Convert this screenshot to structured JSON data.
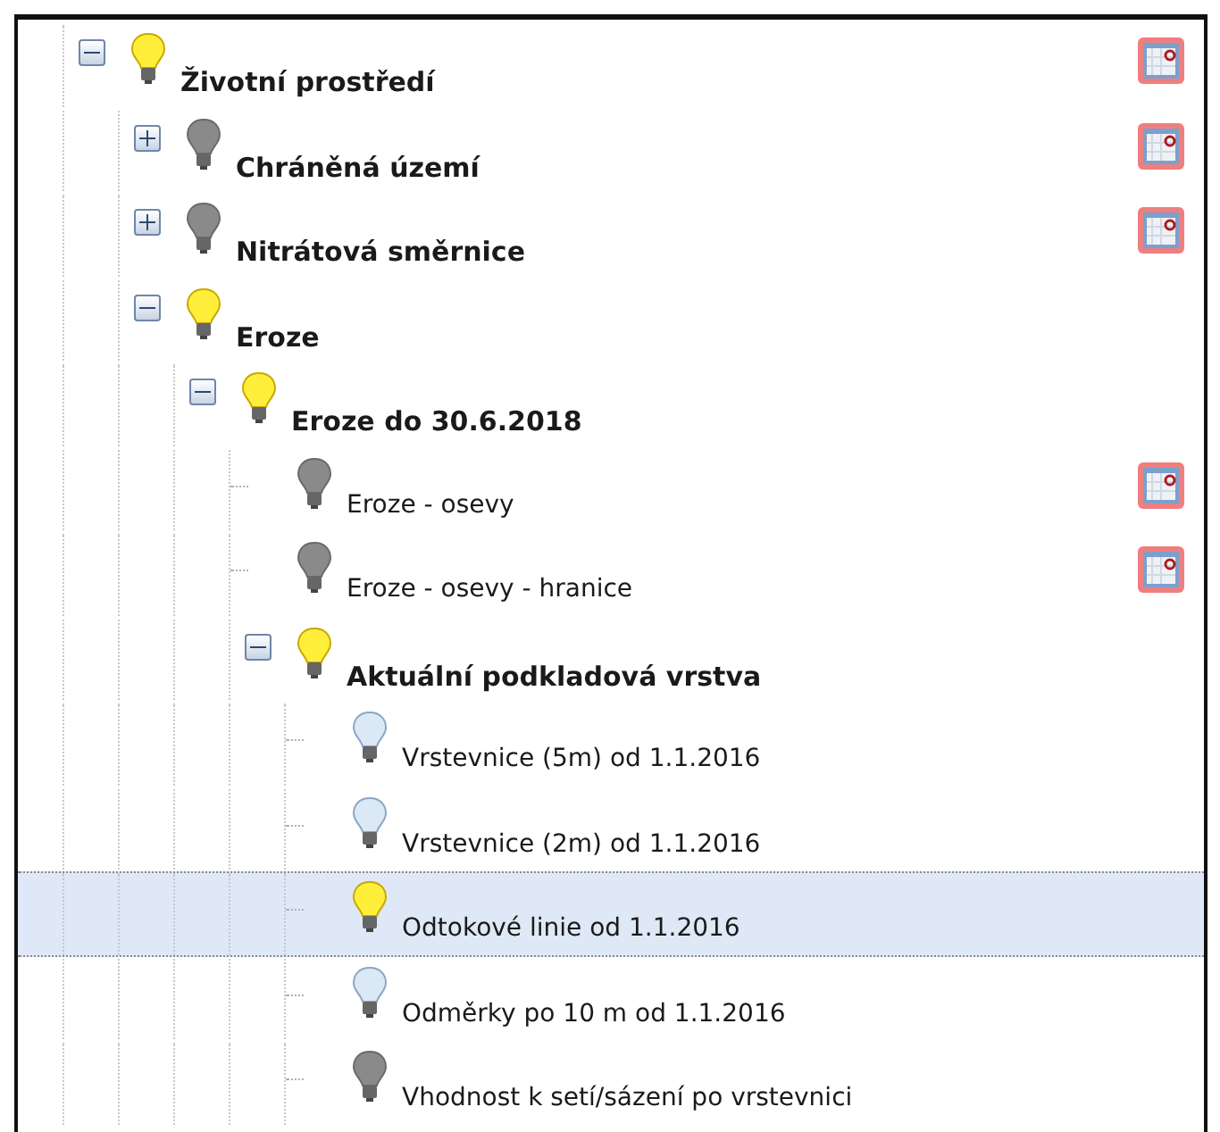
{
  "tree": [
    {
      "label": "Životní prostředí",
      "expanded": true,
      "lit": true,
      "disabled": false,
      "legend": true,
      "selected": false,
      "children": [
        {
          "label": "Chráněná území",
          "expanded": false,
          "lit": false,
          "disabled": true,
          "legend": true,
          "selected": false
        },
        {
          "label": "Nitrátová směrnice",
          "expanded": false,
          "lit": false,
          "disabled": true,
          "legend": true,
          "selected": false
        },
        {
          "label": "Eroze",
          "expanded": true,
          "lit": true,
          "disabled": false,
          "legend": false,
          "selected": false,
          "children": [
            {
              "label": "Eroze do 30.6.2018",
              "expanded": true,
              "lit": true,
              "disabled": false,
              "legend": false,
              "selected": false,
              "children": [
                {
                  "label": "Eroze - osevy",
                  "lit": false,
                  "disabled": true,
                  "legend": true,
                  "selected": false
                },
                {
                  "label": "Eroze - osevy - hranice",
                  "lit": false,
                  "disabled": true,
                  "legend": true,
                  "selected": false
                },
                {
                  "label": "Aktuální podkladová vrstva",
                  "expanded": true,
                  "lit": true,
                  "disabled": false,
                  "legend": false,
                  "selected": false,
                  "children": [
                    {
                      "label": "Vrstevnice (5m) od 1.1.2016",
                      "lit": false,
                      "disabled": false,
                      "legend": false,
                      "selected": false
                    },
                    {
                      "label": "Vrstevnice (2m) od 1.1.2016",
                      "lit": false,
                      "disabled": false,
                      "legend": false,
                      "selected": false
                    },
                    {
                      "label": "Odtokové linie od 1.1.2016",
                      "lit": true,
                      "disabled": false,
                      "legend": false,
                      "selected": true
                    },
                    {
                      "label": "Odměrky po 10 m od 1.1.2016",
                      "lit": false,
                      "disabled": false,
                      "legend": false,
                      "selected": false
                    },
                    {
                      "label": "Vhodnost k setí/sázení po vrstevnici",
                      "lit": false,
                      "disabled": true,
                      "legend": false,
                      "selected": false
                    }
                  ]
                }
              ]
            }
          ]
        }
      ]
    }
  ]
}
